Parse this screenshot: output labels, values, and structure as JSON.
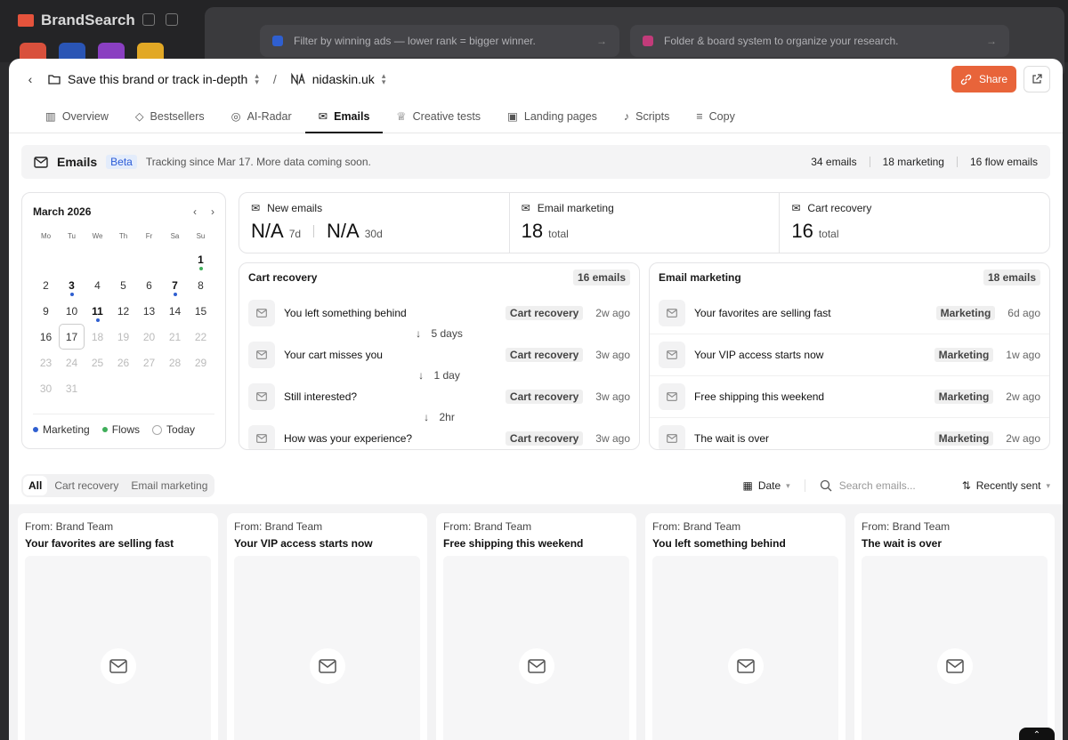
{
  "background": {
    "brand": "BrandSearch",
    "banner_left": "Filter by winning ads — lower rank = bigger winner.",
    "banner_right": "Folder & board system to organize your research."
  },
  "topbar": {
    "breadcrumb_1": "Save this brand or track in-depth",
    "breadcrumb_2": "nidaskin.uk",
    "separator": "/",
    "share_label": "Share"
  },
  "tabs": [
    "Overview",
    "Bestsellers",
    "AI-Radar",
    "Emails",
    "Creative tests",
    "Landing pages",
    "Scripts",
    "Copy"
  ],
  "active_tab": "Emails",
  "emails_bar": {
    "title": "Emails",
    "beta": "Beta",
    "note": "Tracking since Mar 17. More data coming soon.",
    "total": "34 emails",
    "marketing": "18 marketing",
    "flow": "16 flow emails"
  },
  "calendar": {
    "month": "March 2026",
    "dow": [
      "Mo",
      "Tu",
      "We",
      "Th",
      "Fr",
      "Sa",
      "Su"
    ],
    "legend_marketing": "Marketing",
    "legend_flows": "Flows",
    "legend_today": "Today",
    "colors": {
      "marketing": "#2f5fd0",
      "flows": "#3fae5a"
    }
  },
  "stats": {
    "new_emails": {
      "label": "New emails",
      "v1": "N/A",
      "u1": "7d",
      "v2": "N/A",
      "u2": "30d"
    },
    "email_marketing": {
      "label": "Email marketing",
      "value": "18",
      "unit": "total"
    },
    "cart_recovery": {
      "label": "Cart recovery",
      "value": "16",
      "unit": "total"
    }
  },
  "cart_panel": {
    "title": "Cart recovery",
    "count": "16 emails",
    "rows": [
      {
        "subject": "You left something behind",
        "badge": "Cart recovery",
        "ago": "2w ago"
      },
      {
        "subject": "Your cart misses you",
        "badge": "Cart recovery",
        "ago": "3w ago"
      },
      {
        "subject": "Still interested?",
        "badge": "Cart recovery",
        "ago": "3w ago"
      },
      {
        "subject": "How was your experience?",
        "badge": "Cart recovery",
        "ago": "3w ago"
      }
    ],
    "gaps": [
      "5 days",
      "1 day",
      "2hr"
    ]
  },
  "marketing_panel": {
    "title": "Email marketing",
    "count": "18 emails",
    "rows": [
      {
        "subject": "Your favorites are selling fast",
        "badge": "Marketing",
        "ago": "6d ago"
      },
      {
        "subject": "Your VIP access starts now",
        "badge": "Marketing",
        "ago": "1w ago"
      },
      {
        "subject": "Free shipping this weekend",
        "badge": "Marketing",
        "ago": "2w ago"
      },
      {
        "subject": "The wait is over",
        "badge": "Marketing",
        "ago": "2w ago"
      }
    ]
  },
  "filters": {
    "segments": [
      "All",
      "Cart recovery",
      "Email marketing"
    ],
    "date_label": "Date",
    "search_placeholder": "Search emails...",
    "sort_label": "Recently sent"
  },
  "cards": [
    {
      "from": "From: Brand Team",
      "subject": "Your favorites are selling fast"
    },
    {
      "from": "From: Brand Team",
      "subject": "Your VIP access starts now"
    },
    {
      "from": "From: Brand Team",
      "subject": "Free shipping this weekend"
    },
    {
      "from": "From: Brand Team",
      "subject": "You left something behind"
    },
    {
      "from": "From: Brand Team",
      "subject": "The wait is over"
    }
  ],
  "colors": {
    "accent": "#e8643a",
    "beta_bg": "#e3ecfb",
    "beta_text": "#2a5bd7"
  }
}
